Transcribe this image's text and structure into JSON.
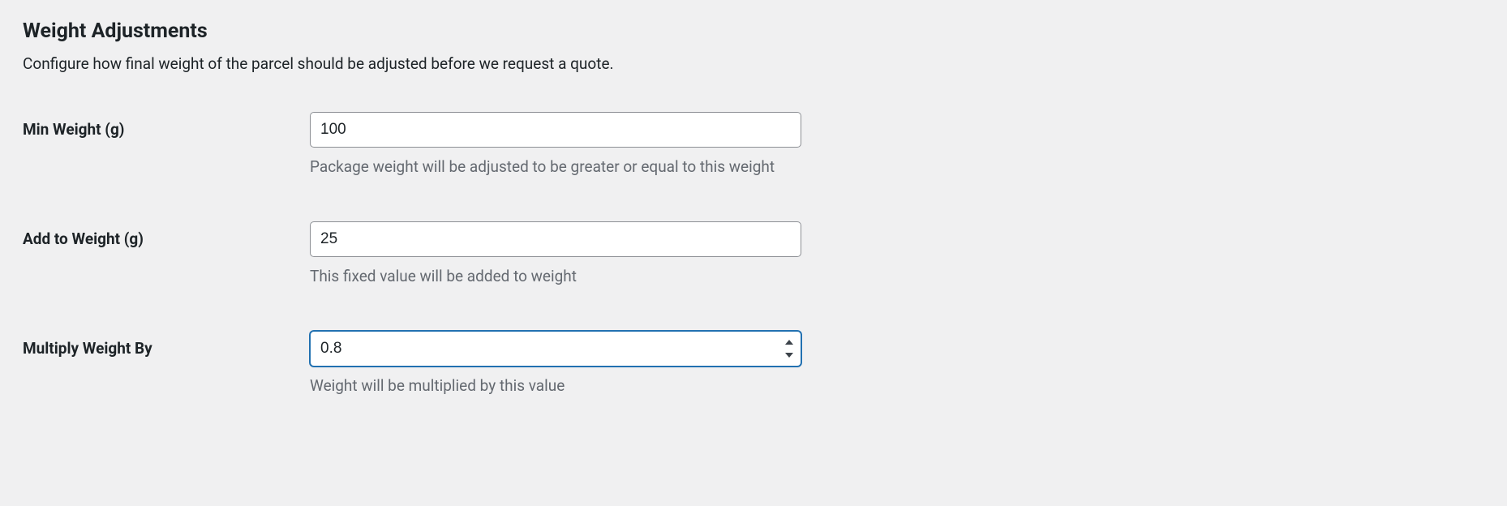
{
  "section": {
    "title": "Weight Adjustments",
    "description": "Configure how final weight of the parcel should be adjusted before we request a quote."
  },
  "fields": {
    "min_weight": {
      "label": "Min Weight (g)",
      "value": "100",
      "help": "Package weight will be adjusted to be greater or equal to this weight"
    },
    "add_weight": {
      "label": "Add to Weight (g)",
      "value": "25",
      "help": "This fixed value will be added to weight"
    },
    "multiply_weight": {
      "label": "Multiply Weight By",
      "value": "0.8",
      "help": "Weight will be multiplied by this value"
    }
  }
}
